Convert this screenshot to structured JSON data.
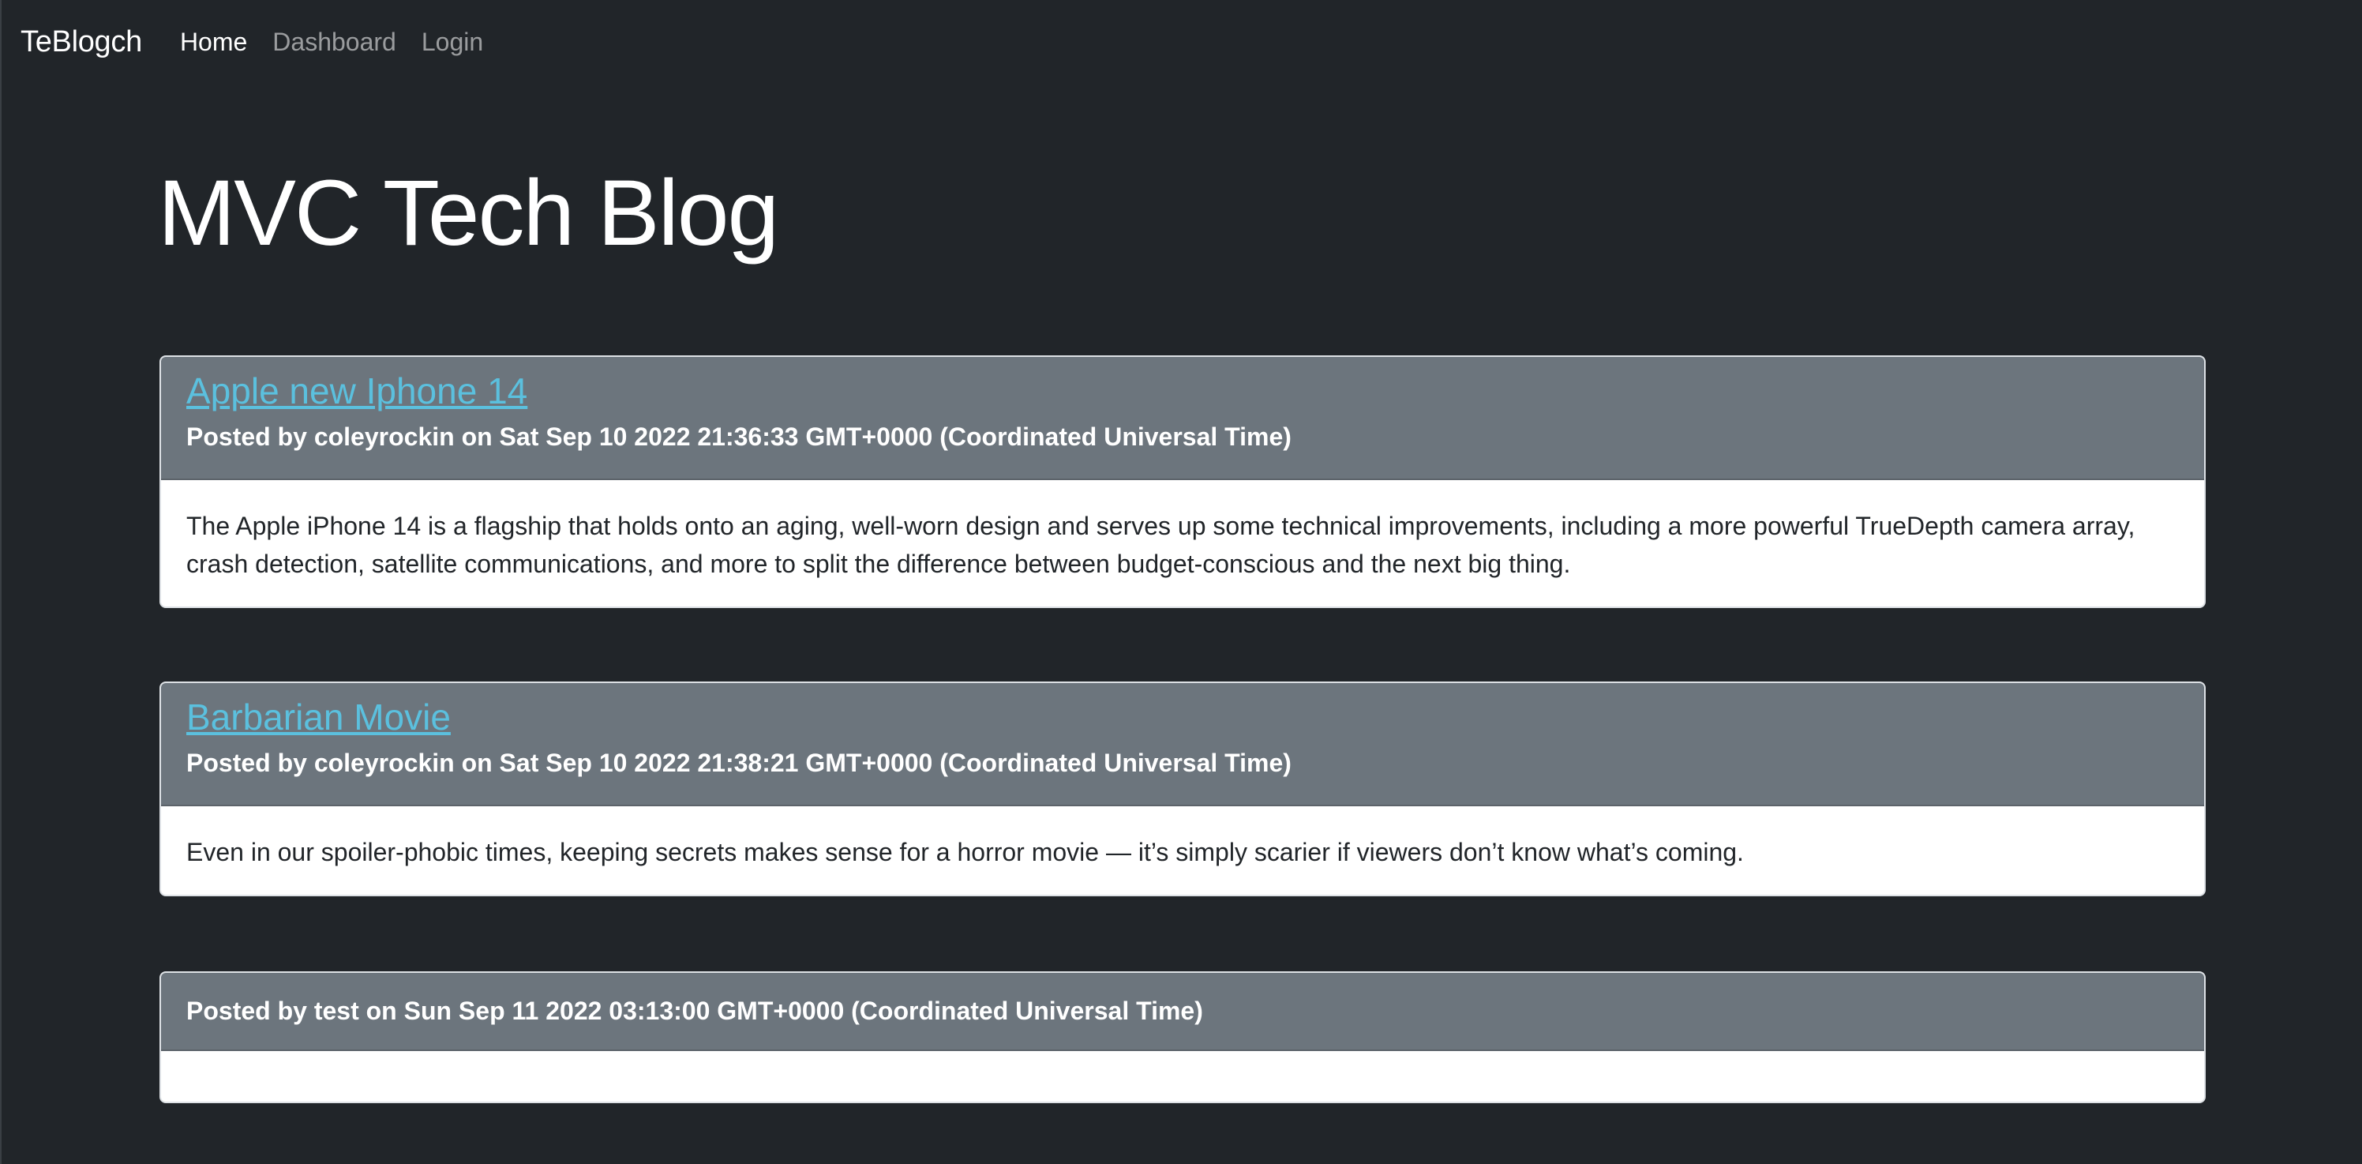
{
  "nav": {
    "brand": "TeBlogch",
    "links": [
      {
        "label": "Home",
        "active": true
      },
      {
        "label": "Dashboard",
        "active": false
      },
      {
        "label": "Login",
        "active": false
      }
    ]
  },
  "page": {
    "title": "MVC Tech Blog"
  },
  "posts": [
    {
      "title": "Apple new Iphone 14",
      "meta": "Posted by coleyrockin on Sat Sep 10 2022 21:36:33 GMT+0000 (Coordinated Universal Time)",
      "body": "The Apple iPhone 14 is a flagship that holds onto an aging, well-worn design and serves up some technical improvements, including a more powerful TrueDepth camera array, crash detection, satellite communications, and more to split the difference between budget-conscious and the next big thing."
    },
    {
      "title": "Barbarian Movie",
      "meta": "Posted by coleyrockin on Sat Sep 10 2022 21:38:21 GMT+0000 (Coordinated Universal Time)",
      "body": "Even in our spoiler-phobic times, keeping secrets makes sense for a horror movie — it’s simply scarier if viewers don’t know what’s coming."
    },
    {
      "title": "",
      "meta": "Posted by test on Sun Sep 11 2022 03:13:00 GMT+0000 (Coordinated Universal Time)",
      "body": ""
    }
  ],
  "colors": {
    "background": "#212529",
    "card_header": "#6c757d",
    "link": "#5bc0de"
  }
}
